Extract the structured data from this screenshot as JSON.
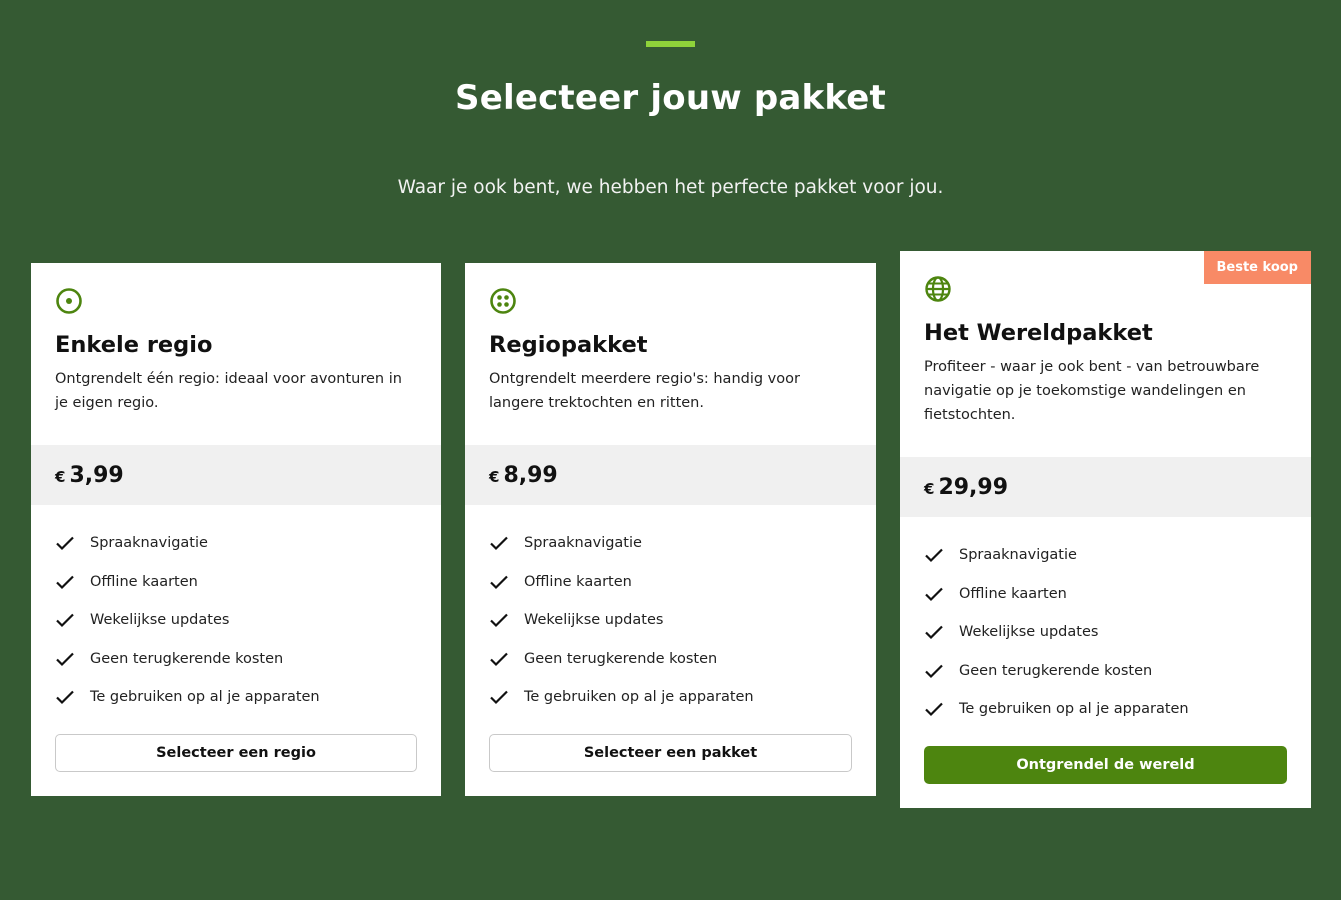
{
  "header": {
    "title": "Selecteer jouw pakket",
    "subtitle": "Waar je ook bent, we hebben het perfecte pakket voor jou."
  },
  "colors": {
    "background": "#355a33",
    "accent_bar": "#8fd33a",
    "icon_green": "#4d850f",
    "cta_green": "#4d850f",
    "badge": "#f88a66"
  },
  "plans": [
    {
      "icon": "target-icon",
      "name": "Enkele regio",
      "description": "Ontgrendelt één regio: ideaal voor avonturen in je eigen regio.",
      "currency": "€",
      "price": "3,99",
      "features": [
        "Spraaknavigatie",
        "Offline kaarten",
        "Wekelijkse updates",
        "Geen terugkerende kosten",
        "Te gebruiken op al je apparaten"
      ],
      "cta": "Selecteer een regio"
    },
    {
      "icon": "dots-grid-icon",
      "name": "Regiopakket",
      "description": "Ontgrendelt meerdere regio's: handig voor langere trektochten en ritten.",
      "currency": "€",
      "price": "8,99",
      "features": [
        "Spraaknavigatie",
        "Offline kaarten",
        "Wekelijkse updates",
        "Geen terugkerende kosten",
        "Te gebruiken op al je apparaten"
      ],
      "cta": "Selecteer een pakket"
    },
    {
      "icon": "globe-icon",
      "badge": "Beste koop",
      "name": "Het Wereldpakket",
      "description": "Profiteer - waar je ook bent - van betrouwbare navigatie op je toekomstige wandelingen en fietstochten.",
      "currency": "€",
      "price": "29,99",
      "features": [
        "Spraaknavigatie",
        "Offline kaarten",
        "Wekelijkse updates",
        "Geen terugkerende kosten",
        "Te gebruiken op al je apparaten"
      ],
      "cta": "Ontgrendel de wereld"
    }
  ]
}
